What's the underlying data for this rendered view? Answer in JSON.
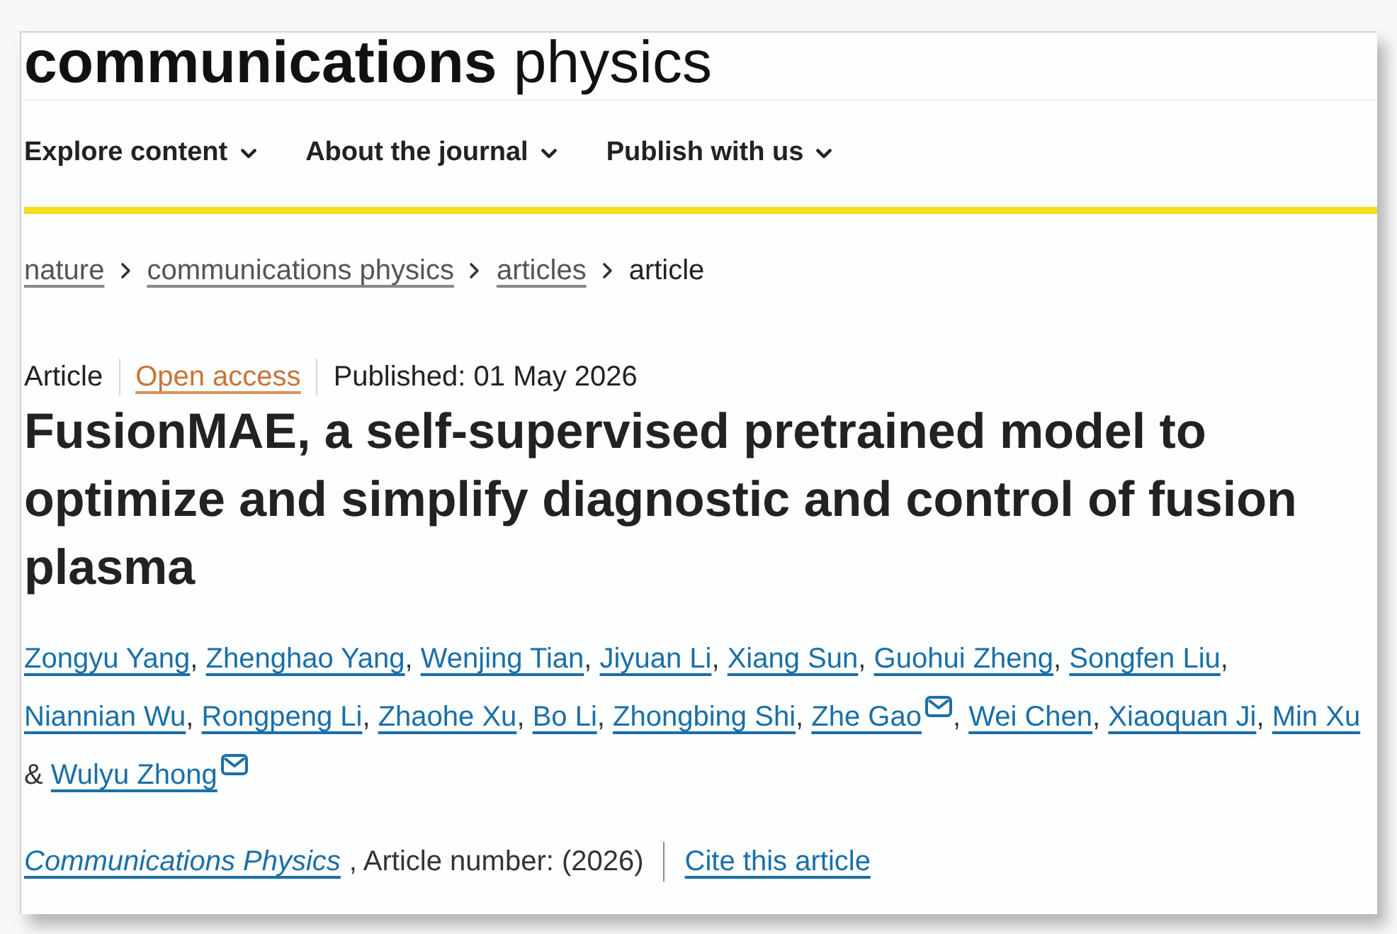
{
  "logo": "**communications** physics",
  "nav": [
    {
      "label": "Explore content"
    },
    {
      "label": "About the journal"
    },
    {
      "label": "Publish with us"
    }
  ],
  "breadcrumb": [
    {
      "label": "nature",
      "current": false
    },
    {
      "label": "communications physics",
      "current": false
    },
    {
      "label": "articles",
      "current": false
    },
    {
      "label": "article",
      "current": true
    }
  ],
  "article": {
    "type": "Article",
    "access": "Open access",
    "published": "Published: 01 May 2026",
    "title": "FusionMAE, a self-supervised pretrained model to optimize and simplify diagnostic and control of fusion plasma",
    "authors": [
      {
        "name": "Zongyu Yang",
        "mail": false
      },
      {
        "name": "Zhenghao Yang",
        "mail": false
      },
      {
        "name": "Wenjing Tian",
        "mail": false
      },
      {
        "name": "Jiyuan Li",
        "mail": false
      },
      {
        "name": "Xiang Sun",
        "mail": false
      },
      {
        "name": "Guohui Zheng",
        "mail": false
      },
      {
        "name": "Songfen Liu",
        "mail": false
      },
      {
        "name": "Niannian Wu",
        "mail": false
      },
      {
        "name": "Rongpeng Li",
        "mail": false
      },
      {
        "name": "Zhaohe Xu",
        "mail": false
      },
      {
        "name": "Bo Li",
        "mail": false
      },
      {
        "name": "Zhongbing Shi",
        "mail": false
      },
      {
        "name": "Zhe Gao",
        "mail": true
      },
      {
        "name": "Wei Chen",
        "mail": false
      },
      {
        "name": "Xiaoquan Ji",
        "mail": false
      },
      {
        "name": "Min Xu",
        "mail": false
      },
      {
        "name": "Wulyu Zhong",
        "mail": true
      }
    ],
    "author_separator": ",",
    "author_joiner": "&"
  },
  "citation": {
    "journal": "Communications Physics",
    "details": ", Article number: (2026)",
    "cite_link": "Cite this article"
  }
}
